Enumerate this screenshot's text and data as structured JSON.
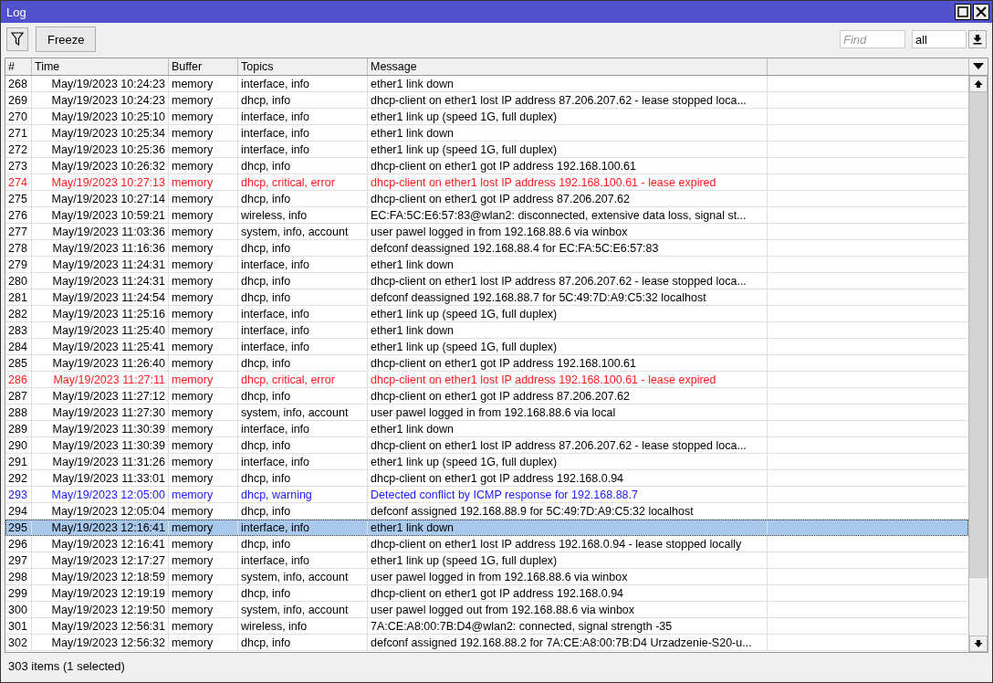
{
  "window": {
    "title": "Log"
  },
  "toolbar": {
    "freeze_label": "Freeze",
    "find": {
      "placeholder": "Find"
    },
    "filter_value": "all"
  },
  "table": {
    "columns": [
      "#",
      "Time",
      "Buffer",
      "Topics",
      "Message"
    ],
    "rows": [
      {
        "num": "268",
        "time": "May/19/2023 10:24:23",
        "buffer": "memory",
        "topics": "interface, info",
        "message": "ether1 link down",
        "kind": "normal",
        "selected": false
      },
      {
        "num": "269",
        "time": "May/19/2023 10:24:23",
        "buffer": "memory",
        "topics": "dhcp, info",
        "message": "dhcp-client on ether1 lost IP address 87.206.207.62 - lease stopped loca...",
        "kind": "normal",
        "selected": false
      },
      {
        "num": "270",
        "time": "May/19/2023 10:25:10",
        "buffer": "memory",
        "topics": "interface, info",
        "message": "ether1 link up (speed 1G, full duplex)",
        "kind": "normal",
        "selected": false
      },
      {
        "num": "271",
        "time": "May/19/2023 10:25:34",
        "buffer": "memory",
        "topics": "interface, info",
        "message": "ether1 link down",
        "kind": "normal",
        "selected": false
      },
      {
        "num": "272",
        "time": "May/19/2023 10:25:36",
        "buffer": "memory",
        "topics": "interface, info",
        "message": "ether1 link up (speed 1G, full duplex)",
        "kind": "normal",
        "selected": false
      },
      {
        "num": "273",
        "time": "May/19/2023 10:26:32",
        "buffer": "memory",
        "topics": "dhcp, info",
        "message": "dhcp-client on ether1 got IP address 192.168.100.61",
        "kind": "normal",
        "selected": false
      },
      {
        "num": "274",
        "time": "May/19/2023 10:27:13",
        "buffer": "memory",
        "topics": "dhcp, critical, error",
        "message": "dhcp-client on ether1 lost IP address 192.168.100.61 - lease expired",
        "kind": "error",
        "selected": false
      },
      {
        "num": "275",
        "time": "May/19/2023 10:27:14",
        "buffer": "memory",
        "topics": "dhcp, info",
        "message": "dhcp-client on ether1 got IP address 87.206.207.62",
        "kind": "normal",
        "selected": false
      },
      {
        "num": "276",
        "time": "May/19/2023 10:59:21",
        "buffer": "memory",
        "topics": "wireless, info",
        "message": "EC:FA:5C:E6:57:83@wlan2: disconnected, extensive data loss, signal st...",
        "kind": "normal",
        "selected": false
      },
      {
        "num": "277",
        "time": "May/19/2023 11:03:36",
        "buffer": "memory",
        "topics": "system, info, account",
        "message": "user pawel logged in from 192.168.88.6 via winbox",
        "kind": "normal",
        "selected": false
      },
      {
        "num": "278",
        "time": "May/19/2023 11:16:36",
        "buffer": "memory",
        "topics": "dhcp, info",
        "message": "defconf deassigned 192.168.88.4 for EC:FA:5C:E6:57:83",
        "kind": "normal",
        "selected": false
      },
      {
        "num": "279",
        "time": "May/19/2023 11:24:31",
        "buffer": "memory",
        "topics": "interface, info",
        "message": "ether1 link down",
        "kind": "normal",
        "selected": false
      },
      {
        "num": "280",
        "time": "May/19/2023 11:24:31",
        "buffer": "memory",
        "topics": "dhcp, info",
        "message": "dhcp-client on ether1 lost IP address 87.206.207.62 - lease stopped loca...",
        "kind": "normal",
        "selected": false
      },
      {
        "num": "281",
        "time": "May/19/2023 11:24:54",
        "buffer": "memory",
        "topics": "dhcp, info",
        "message": "defconf deassigned 192.168.88.7 for 5C:49:7D:A9:C5:32 localhost",
        "kind": "normal",
        "selected": false
      },
      {
        "num": "282",
        "time": "May/19/2023 11:25:16",
        "buffer": "memory",
        "topics": "interface, info",
        "message": "ether1 link up (speed 1G, full duplex)",
        "kind": "normal",
        "selected": false
      },
      {
        "num": "283",
        "time": "May/19/2023 11:25:40",
        "buffer": "memory",
        "topics": "interface, info",
        "message": "ether1 link down",
        "kind": "normal",
        "selected": false
      },
      {
        "num": "284",
        "time": "May/19/2023 11:25:41",
        "buffer": "memory",
        "topics": "interface, info",
        "message": "ether1 link up (speed 1G, full duplex)",
        "kind": "normal",
        "selected": false
      },
      {
        "num": "285",
        "time": "May/19/2023 11:26:40",
        "buffer": "memory",
        "topics": "dhcp, info",
        "message": "dhcp-client on ether1 got IP address 192.168.100.61",
        "kind": "normal",
        "selected": false
      },
      {
        "num": "286",
        "time": "May/19/2023 11:27:11",
        "buffer": "memory",
        "topics": "dhcp, critical, error",
        "message": "dhcp-client on ether1 lost IP address 192.168.100.61 - lease expired",
        "kind": "error",
        "selected": false
      },
      {
        "num": "287",
        "time": "May/19/2023 11:27:12",
        "buffer": "memory",
        "topics": "dhcp, info",
        "message": "dhcp-client on ether1 got IP address 87.206.207.62",
        "kind": "normal",
        "selected": false
      },
      {
        "num": "288",
        "time": "May/19/2023 11:27:30",
        "buffer": "memory",
        "topics": "system, info, account",
        "message": "user pawel logged in from 192.168.88.6 via local",
        "kind": "normal",
        "selected": false
      },
      {
        "num": "289",
        "time": "May/19/2023 11:30:39",
        "buffer": "memory",
        "topics": "interface, info",
        "message": "ether1 link down",
        "kind": "normal",
        "selected": false
      },
      {
        "num": "290",
        "time": "May/19/2023 11:30:39",
        "buffer": "memory",
        "topics": "dhcp, info",
        "message": "dhcp-client on ether1 lost IP address 87.206.207.62 - lease stopped loca...",
        "kind": "normal",
        "selected": false
      },
      {
        "num": "291",
        "time": "May/19/2023 11:31:26",
        "buffer": "memory",
        "topics": "interface, info",
        "message": "ether1 link up (speed 1G, full duplex)",
        "kind": "normal",
        "selected": false
      },
      {
        "num": "292",
        "time": "May/19/2023 11:33:01",
        "buffer": "memory",
        "topics": "dhcp, info",
        "message": "dhcp-client on ether1 got IP address 192.168.0.94",
        "kind": "normal",
        "selected": false
      },
      {
        "num": "293",
        "time": "May/19/2023 12:05:00",
        "buffer": "memory",
        "topics": "dhcp, warning",
        "message": "Detected conflict by ICMP response for 192.168.88.7",
        "kind": "warning",
        "selected": false
      },
      {
        "num": "294",
        "time": "May/19/2023 12:05:04",
        "buffer": "memory",
        "topics": "dhcp, info",
        "message": "defconf assigned 192.168.88.9 for 5C:49:7D:A9:C5:32 localhost",
        "kind": "normal",
        "selected": false
      },
      {
        "num": "295",
        "time": "May/19/2023 12:16:41",
        "buffer": "memory",
        "topics": "interface, info",
        "message": "ether1 link down",
        "kind": "normal",
        "selected": true
      },
      {
        "num": "296",
        "time": "May/19/2023 12:16:41",
        "buffer": "memory",
        "topics": "dhcp, info",
        "message": "dhcp-client on ether1 lost IP address 192.168.0.94 - lease stopped locally",
        "kind": "normal",
        "selected": false
      },
      {
        "num": "297",
        "time": "May/19/2023 12:17:27",
        "buffer": "memory",
        "topics": "interface, info",
        "message": "ether1 link up (speed 1G, full duplex)",
        "kind": "normal",
        "selected": false
      },
      {
        "num": "298",
        "time": "May/19/2023 12:18:59",
        "buffer": "memory",
        "topics": "system, info, account",
        "message": "user pawel logged in from 192.168.88.6 via winbox",
        "kind": "normal",
        "selected": false
      },
      {
        "num": "299",
        "time": "May/19/2023 12:19:19",
        "buffer": "memory",
        "topics": "dhcp, info",
        "message": "dhcp-client on ether1 got IP address 192.168.0.94",
        "kind": "normal",
        "selected": false
      },
      {
        "num": "300",
        "time": "May/19/2023 12:19:50",
        "buffer": "memory",
        "topics": "system, info, account",
        "message": "user pawel logged out from 192.168.88.6 via winbox",
        "kind": "normal",
        "selected": false
      },
      {
        "num": "301",
        "time": "May/19/2023 12:56:31",
        "buffer": "memory",
        "topics": "wireless, info",
        "message": "7A:CE:A8:00:7B:D4@wlan2: connected, signal strength -35",
        "kind": "normal",
        "selected": false
      },
      {
        "num": "302",
        "time": "May/19/2023 12:56:32",
        "buffer": "memory",
        "topics": "dhcp, info",
        "message": "defconf assigned 192.168.88.2 for 7A:CE:A8:00:7B:D4 Urzadzenie-S20-u...",
        "kind": "normal",
        "selected": false
      }
    ]
  },
  "status_bar": "303 items (1 selected)"
}
